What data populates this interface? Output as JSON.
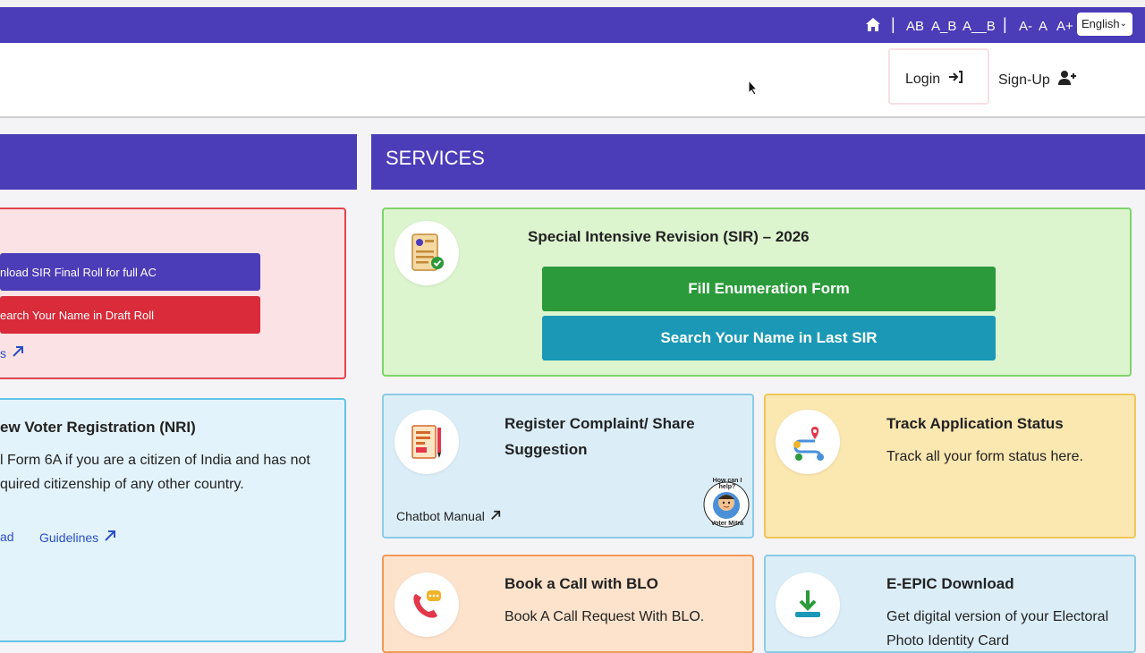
{
  "topbar": {
    "font_ab": "AB",
    "font_ab_spaced": "A_B",
    "font_a_b_wide": "A__B",
    "size_minus": "A-",
    "size_normal": "A",
    "size_plus": "A+",
    "language": "English"
  },
  "header": {
    "login_label": "Login",
    "signup_label": "Sign-Up"
  },
  "left_panel": {
    "sir_card": {
      "download_button": "nload SIR Final Roll for full AC",
      "search_button": "earch Your Name in Draft Roll",
      "link_text": "s"
    },
    "nri_card": {
      "title": "ew Voter Registration (NRI)",
      "line1": "l Form 6A if you are a citizen of India and has not",
      "line2": "quired citizenship of any other country.",
      "download_link": "ad",
      "guidelines_link": "Guidelines"
    }
  },
  "services": {
    "heading": "SERVICES",
    "sir": {
      "title": "Special Intensive Revision (SIR) – 2026",
      "fill_button": "Fill Enumeration Form",
      "search_button": "Search Your Name in Last SIR",
      "icon": "checklist-icon"
    },
    "complaint": {
      "title_line1": "Register Complaint/ Share",
      "title_line2": "Suggestion",
      "link": "Chatbot Manual",
      "mascot_text_top": "How can I help?",
      "mascot_text_bottom": "Voter Mitra"
    },
    "track": {
      "title": "Track Application Status",
      "desc": "Track all your form status here."
    },
    "blo": {
      "title": "Book a Call with BLO",
      "desc": "Book A Call Request With BLO."
    },
    "epic": {
      "title": "E-EPIC Download",
      "desc_line1": "Get digital version of your Electoral",
      "desc_line2": "Photo Identity Card"
    }
  },
  "colors": {
    "brand": "#4b3cb8",
    "green_button": "#2a9a3a",
    "teal_button": "#1a98b5",
    "red_button": "#d92b3a"
  }
}
